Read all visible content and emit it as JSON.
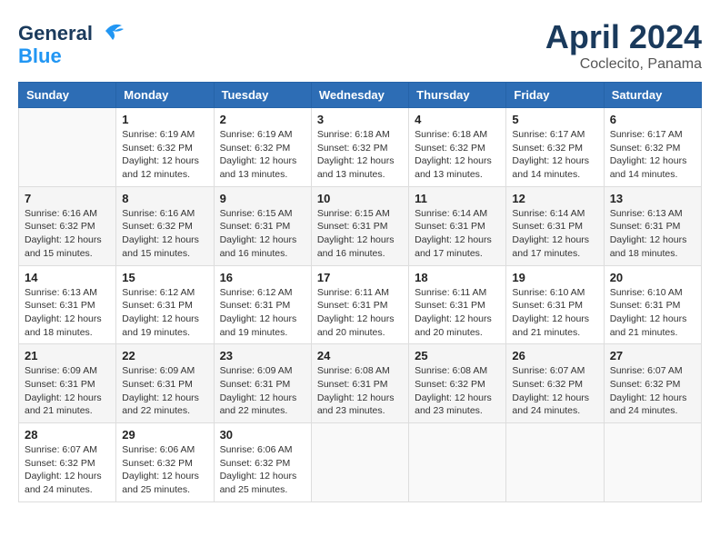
{
  "header": {
    "logo_line1": "General",
    "logo_line2": "Blue",
    "month": "April 2024",
    "location": "Coclecito, Panama"
  },
  "days_of_week": [
    "Sunday",
    "Monday",
    "Tuesday",
    "Wednesday",
    "Thursday",
    "Friday",
    "Saturday"
  ],
  "weeks": [
    [
      {
        "day": "",
        "sunrise": "",
        "sunset": "",
        "daylight": ""
      },
      {
        "day": "1",
        "sunrise": "Sunrise: 6:19 AM",
        "sunset": "Sunset: 6:32 PM",
        "daylight": "Daylight: 12 hours and 12 minutes."
      },
      {
        "day": "2",
        "sunrise": "Sunrise: 6:19 AM",
        "sunset": "Sunset: 6:32 PM",
        "daylight": "Daylight: 12 hours and 13 minutes."
      },
      {
        "day": "3",
        "sunrise": "Sunrise: 6:18 AM",
        "sunset": "Sunset: 6:32 PM",
        "daylight": "Daylight: 12 hours and 13 minutes."
      },
      {
        "day": "4",
        "sunrise": "Sunrise: 6:18 AM",
        "sunset": "Sunset: 6:32 PM",
        "daylight": "Daylight: 12 hours and 13 minutes."
      },
      {
        "day": "5",
        "sunrise": "Sunrise: 6:17 AM",
        "sunset": "Sunset: 6:32 PM",
        "daylight": "Daylight: 12 hours and 14 minutes."
      },
      {
        "day": "6",
        "sunrise": "Sunrise: 6:17 AM",
        "sunset": "Sunset: 6:32 PM",
        "daylight": "Daylight: 12 hours and 14 minutes."
      }
    ],
    [
      {
        "day": "7",
        "sunrise": "Sunrise: 6:16 AM",
        "sunset": "Sunset: 6:32 PM",
        "daylight": "Daylight: 12 hours and 15 minutes."
      },
      {
        "day": "8",
        "sunrise": "Sunrise: 6:16 AM",
        "sunset": "Sunset: 6:32 PM",
        "daylight": "Daylight: 12 hours and 15 minutes."
      },
      {
        "day": "9",
        "sunrise": "Sunrise: 6:15 AM",
        "sunset": "Sunset: 6:31 PM",
        "daylight": "Daylight: 12 hours and 16 minutes."
      },
      {
        "day": "10",
        "sunrise": "Sunrise: 6:15 AM",
        "sunset": "Sunset: 6:31 PM",
        "daylight": "Daylight: 12 hours and 16 minutes."
      },
      {
        "day": "11",
        "sunrise": "Sunrise: 6:14 AM",
        "sunset": "Sunset: 6:31 PM",
        "daylight": "Daylight: 12 hours and 17 minutes."
      },
      {
        "day": "12",
        "sunrise": "Sunrise: 6:14 AM",
        "sunset": "Sunset: 6:31 PM",
        "daylight": "Daylight: 12 hours and 17 minutes."
      },
      {
        "day": "13",
        "sunrise": "Sunrise: 6:13 AM",
        "sunset": "Sunset: 6:31 PM",
        "daylight": "Daylight: 12 hours and 18 minutes."
      }
    ],
    [
      {
        "day": "14",
        "sunrise": "Sunrise: 6:13 AM",
        "sunset": "Sunset: 6:31 PM",
        "daylight": "Daylight: 12 hours and 18 minutes."
      },
      {
        "day": "15",
        "sunrise": "Sunrise: 6:12 AM",
        "sunset": "Sunset: 6:31 PM",
        "daylight": "Daylight: 12 hours and 19 minutes."
      },
      {
        "day": "16",
        "sunrise": "Sunrise: 6:12 AM",
        "sunset": "Sunset: 6:31 PM",
        "daylight": "Daylight: 12 hours and 19 minutes."
      },
      {
        "day": "17",
        "sunrise": "Sunrise: 6:11 AM",
        "sunset": "Sunset: 6:31 PM",
        "daylight": "Daylight: 12 hours and 20 minutes."
      },
      {
        "day": "18",
        "sunrise": "Sunrise: 6:11 AM",
        "sunset": "Sunset: 6:31 PM",
        "daylight": "Daylight: 12 hours and 20 minutes."
      },
      {
        "day": "19",
        "sunrise": "Sunrise: 6:10 AM",
        "sunset": "Sunset: 6:31 PM",
        "daylight": "Daylight: 12 hours and 21 minutes."
      },
      {
        "day": "20",
        "sunrise": "Sunrise: 6:10 AM",
        "sunset": "Sunset: 6:31 PM",
        "daylight": "Daylight: 12 hours and 21 minutes."
      }
    ],
    [
      {
        "day": "21",
        "sunrise": "Sunrise: 6:09 AM",
        "sunset": "Sunset: 6:31 PM",
        "daylight": "Daylight: 12 hours and 21 minutes."
      },
      {
        "day": "22",
        "sunrise": "Sunrise: 6:09 AM",
        "sunset": "Sunset: 6:31 PM",
        "daylight": "Daylight: 12 hours and 22 minutes."
      },
      {
        "day": "23",
        "sunrise": "Sunrise: 6:09 AM",
        "sunset": "Sunset: 6:31 PM",
        "daylight": "Daylight: 12 hours and 22 minutes."
      },
      {
        "day": "24",
        "sunrise": "Sunrise: 6:08 AM",
        "sunset": "Sunset: 6:31 PM",
        "daylight": "Daylight: 12 hours and 23 minutes."
      },
      {
        "day": "25",
        "sunrise": "Sunrise: 6:08 AM",
        "sunset": "Sunset: 6:32 PM",
        "daylight": "Daylight: 12 hours and 23 minutes."
      },
      {
        "day": "26",
        "sunrise": "Sunrise: 6:07 AM",
        "sunset": "Sunset: 6:32 PM",
        "daylight": "Daylight: 12 hours and 24 minutes."
      },
      {
        "day": "27",
        "sunrise": "Sunrise: 6:07 AM",
        "sunset": "Sunset: 6:32 PM",
        "daylight": "Daylight: 12 hours and 24 minutes."
      }
    ],
    [
      {
        "day": "28",
        "sunrise": "Sunrise: 6:07 AM",
        "sunset": "Sunset: 6:32 PM",
        "daylight": "Daylight: 12 hours and 24 minutes."
      },
      {
        "day": "29",
        "sunrise": "Sunrise: 6:06 AM",
        "sunset": "Sunset: 6:32 PM",
        "daylight": "Daylight: 12 hours and 25 minutes."
      },
      {
        "day": "30",
        "sunrise": "Sunrise: 6:06 AM",
        "sunset": "Sunset: 6:32 PM",
        "daylight": "Daylight: 12 hours and 25 minutes."
      },
      {
        "day": "",
        "sunrise": "",
        "sunset": "",
        "daylight": ""
      },
      {
        "day": "",
        "sunrise": "",
        "sunset": "",
        "daylight": ""
      },
      {
        "day": "",
        "sunrise": "",
        "sunset": "",
        "daylight": ""
      },
      {
        "day": "",
        "sunrise": "",
        "sunset": "",
        "daylight": ""
      }
    ]
  ]
}
